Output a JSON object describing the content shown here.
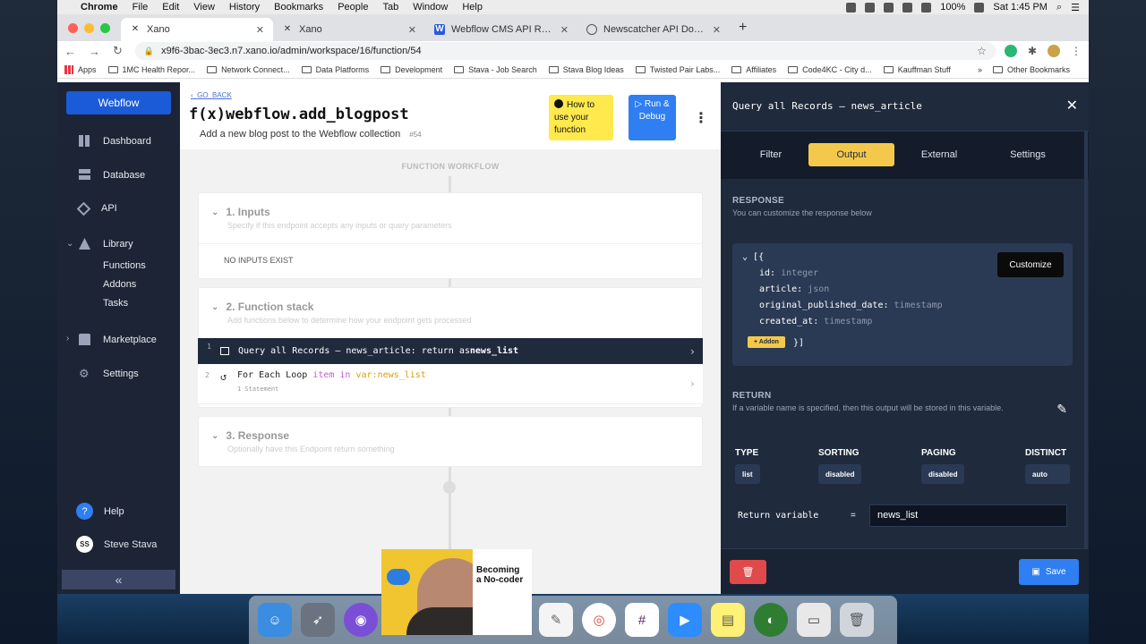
{
  "menubar": {
    "app": "Chrome",
    "items": [
      "File",
      "Edit",
      "View",
      "History",
      "Bookmarks",
      "People",
      "Tab",
      "Window",
      "Help"
    ],
    "battery": "100%",
    "clock": "Sat 1:45 PM"
  },
  "tabs": [
    {
      "label": "Xano",
      "icon": "xano-icon",
      "active": true
    },
    {
      "label": "Xano",
      "icon": "xano-icon",
      "active": false
    },
    {
      "label": "Webflow CMS API Reference",
      "icon": "webflow-icon",
      "active": false
    },
    {
      "label": "Newscatcher API Documentati",
      "icon": "globe-icon",
      "active": false
    }
  ],
  "address": {
    "url": "x9f6-3bac-3ec3.n7.xano.io/admin/workspace/16/function/54"
  },
  "bookmarks": [
    "Apps",
    "1MC Health Repor...",
    "Network Connect...",
    "Data Platforms",
    "Development",
    "Stava - Job Search",
    "Stava Blog Ideas",
    "Twisted Pair Labs...",
    "Affiliates",
    "Code4KC - City d...",
    "Kauffman Stuff"
  ],
  "bookmarks_more": "»",
  "bookmarks_other": "Other Bookmarks",
  "sidebar": {
    "brand": "Webflow",
    "items": {
      "dashboard": "Dashboard",
      "database": "Database",
      "api": "API",
      "library": "Library",
      "functions": "Functions",
      "addons": "Addons",
      "tasks": "Tasks",
      "marketplace": "Marketplace",
      "settings": "Settings",
      "help": "Help"
    },
    "user": {
      "initials": "SS",
      "name": "Steve Stava"
    },
    "collapse": "«"
  },
  "function": {
    "go_back": "GO_BACK",
    "name": "webflow.add_blogpost",
    "prefix": "f(x)",
    "description": "Add a new blog post to the Webflow collection",
    "id": "#54",
    "howto": "How to use your function",
    "run": "Run & Debug"
  },
  "workflow": {
    "title": "FUNCTION WORKFLOW",
    "inputs": {
      "title": "1. Inputs",
      "subtitle": "Specify if this endpoint accepts any inputs or query parameters",
      "empty": "NO INPUTS EXIST"
    },
    "stack": {
      "title": "2. Function stack",
      "subtitle": "Add functions below to determine how your endpoint gets processed",
      "rows": [
        {
          "num": "1",
          "text": "Query all Records – news_article: return as ",
          "var": "news_list"
        },
        {
          "num": "2",
          "text": "For Each Loop ",
          "item": "item",
          "in": " in ",
          "var": "var:news_list",
          "sub": "1 Statement"
        }
      ]
    },
    "response": {
      "title": "3. Response",
      "subtitle": "Optionally have this Endpoint return something"
    }
  },
  "panel": {
    "title": "Query all Records – news_article",
    "tabs": [
      "Filter",
      "Output",
      "External",
      "Settings"
    ],
    "active_tab": "Output",
    "response_h": "RESPONSE",
    "response_s": "You can customize the response below",
    "customize": "Customize",
    "code_open": "[{",
    "code_close": "}]",
    "fields": [
      {
        "name": "id:",
        "type": "integer"
      },
      {
        "name": "article:",
        "type": "json"
      },
      {
        "name": "original_published_date:",
        "type": "timestamp"
      },
      {
        "name": "created_at:",
        "type": "timestamp"
      }
    ],
    "addon": "+ Addon",
    "return_h": "RETURN",
    "return_s": "If a variable name is specified, then this output will be stored in this variable.",
    "cols": [
      {
        "label": "TYPE",
        "value": "list"
      },
      {
        "label": "SORTING",
        "value": "disabled"
      },
      {
        "label": "PAGING",
        "value": "disabled"
      },
      {
        "label": "DISTINCT",
        "value": "auto"
      }
    ],
    "return_var_label": "Return variable",
    "eq": "=",
    "return_var": "news_list",
    "save": "Save"
  },
  "video": {
    "line1": "Becoming",
    "line2": "a No-coder"
  },
  "colors": {
    "sidebar": "#1d2435",
    "panel": "#1f2a3d",
    "accent_yellow": "#f4c94b",
    "accent_blue": "#2f7ef2",
    "danger": "#e04a4a"
  }
}
